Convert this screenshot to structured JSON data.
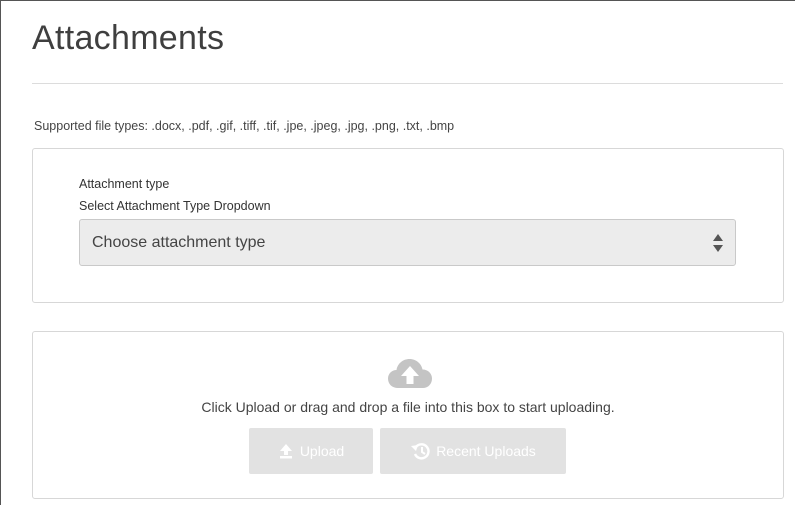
{
  "page": {
    "title": "Attachments",
    "supported_types": "Supported file types: .docx, .pdf, .gif, .tiff, .tif, .jpe, .jpeg, .jpg, .png, .txt, .bmp"
  },
  "attachment_type": {
    "label": "Attachment type",
    "sublabel": "Select Attachment Type Dropdown",
    "selected": "Choose attachment type",
    "arrow_icon": "up-down-caret-icon"
  },
  "upload": {
    "icon": "cloud-upload-icon",
    "instructions": "Click Upload or drag and drop a file into this box to start uploading.",
    "upload_button": "Upload",
    "upload_icon": "upload-arrow-icon",
    "recent_button": "Recent Uploads",
    "recent_icon": "history-icon"
  },
  "colors": {
    "disabled_button_bg": "#e2e2e2",
    "select_bg": "#ececec",
    "border": "#d7d7d7"
  }
}
